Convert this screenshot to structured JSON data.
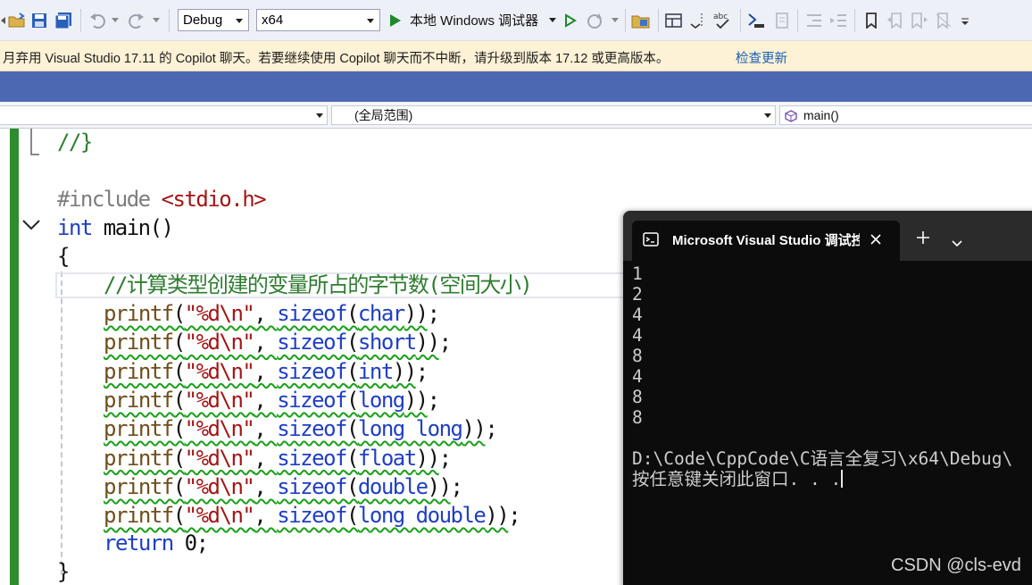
{
  "toolbar": {
    "config": "Debug",
    "platform": "x64",
    "run_target": "本地 Windows 调试器"
  },
  "infobar": {
    "message": "月弃用 Visual Studio 17.11 的 Copilot 聊天。若要继续使用 Copilot 聊天而不中断，请升级到版本 17.12 或更高版本。",
    "link": "检查更新"
  },
  "navbar": {
    "project": "",
    "scope": "(全局范围)",
    "member": "main()"
  },
  "code": {
    "line1": "//}",
    "include_directive": "#include",
    "include_header": "<stdio.h>",
    "kw_int": "int",
    "main_sig": " main()",
    "brace_open": "{",
    "comment": "//计算类型创建的变量所占的字节数(空间大小)",
    "printf": "printf",
    "fmt": "\"%d\\n\"",
    "sizeof": "sizeof",
    "types": [
      "char",
      "short",
      "int",
      "long",
      "long long",
      "float",
      "double",
      "long double"
    ],
    "kw_return": "return",
    "return_value": " 0;",
    "brace_close": "}"
  },
  "console": {
    "tab_title": "Microsoft Visual Studio 调试控制台",
    "output_values": [
      "1",
      "2",
      "4",
      "4",
      "8",
      "4",
      "8",
      "8"
    ],
    "path_line": "D:\\Code\\CppCode\\C语言全复习\\x64\\Debug\\",
    "close_prompt": "按任意键关闭此窗口. . ."
  },
  "watermark": "CSDN @cls-evd",
  "colors": {
    "toolbar_bg": "#eef0f8",
    "infobar_bg": "#fdf1d6",
    "tabstrip_bg": "#4d68b3",
    "change_bar": "#2e8b2e",
    "keyword": "#1f3fc4",
    "string": "#a31515",
    "comment": "#2f7d32",
    "console_bg": "#0c0c0c"
  },
  "icons": [
    "new-project-icon",
    "open-folder-icon",
    "save-icon",
    "save-all-icon",
    "undo-icon",
    "redo-icon",
    "start-debug-icon",
    "start-without-debug-icon",
    "hot-reload-icon",
    "solution-explorer-icon",
    "window-layout-icon",
    "spell-check-icon",
    "breakpoint-icon",
    "format-icon",
    "indent-icon",
    "bookmark-icon",
    "terminal-icon",
    "close-icon",
    "new-tab-icon",
    "chevron-down-icon",
    "collapse-chevron-icon",
    "class-icon"
  ]
}
